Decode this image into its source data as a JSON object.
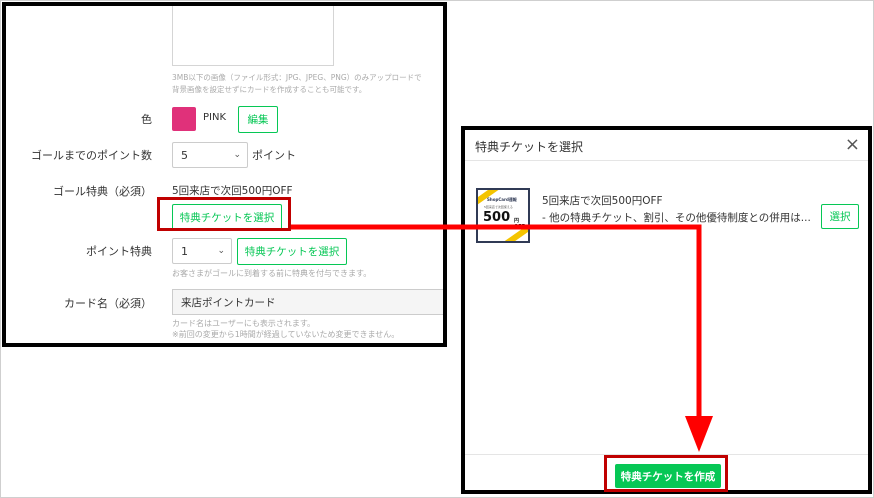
{
  "form": {
    "image_note_1": "3MB以下の画像（ファイル形式：JPG、JPEG、PNG）のみアップロードで",
    "image_note_2": "背景画像を設定せずにカードを作成することも可能です。",
    "color_label": "色",
    "color_value": "PINK",
    "color_hex": "#e0317a",
    "edit_button": "編集",
    "goal_points_label": "ゴールまでのポイント数",
    "goal_points_value": "5",
    "goal_points_unit": "ポイント",
    "goal_reward_label": "ゴール特典（必須）",
    "goal_reward_value": "5回来店で次回500円OFF",
    "select_ticket_button": "特典チケットを選択",
    "point_reward_label": "ポイント特典",
    "point_reward_value": "1",
    "point_reward_button": "特典チケットを選択",
    "point_reward_note": "お客さまがゴールに到着する前に特典を付与できます。",
    "card_name_label": "カード名（必須）",
    "card_name_value": "来店ポイントカード",
    "card_name_note_1": "カード名はユーザーにも表示されます。",
    "card_name_note_2": "※前回の変更から1時間が経過していないため変更できません。"
  },
  "modal": {
    "title": "特典チケットを選択",
    "close_icon": "×",
    "ticket": {
      "thumb_brand": "ShopCard速報",
      "thumb_sub": "5回来店で次回使える",
      "thumb_amount": "500",
      "thumb_suffix": "円OFF",
      "name": "5回来店で次回500円OFF",
      "description": "- 他の特典チケット、割引、その他優待制度との併用は..."
    },
    "select_button": "選択",
    "create_button": "特典チケットを作成"
  },
  "colors": {
    "accent_green": "#06c755",
    "highlight_red": "#c00000",
    "arrow_red": "#ff0000"
  }
}
